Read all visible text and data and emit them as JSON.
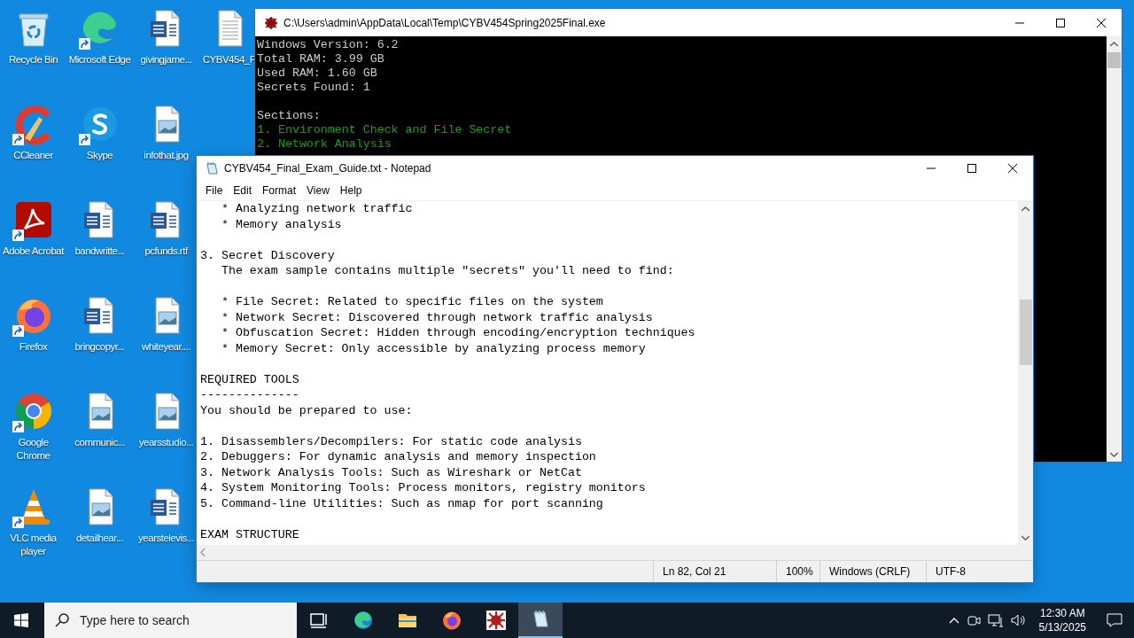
{
  "desktop_icons": [
    {
      "label": "Recycle Bin",
      "kind": "recycle",
      "shortcut": false
    },
    {
      "label": "CCleaner",
      "kind": "ccleaner",
      "shortcut": true
    },
    {
      "label": "Adobe Acrobat",
      "kind": "acrobat",
      "shortcut": true
    },
    {
      "label": "Firefox",
      "kind": "firefox",
      "shortcut": true
    },
    {
      "label": "Google Chrome",
      "kind": "chrome",
      "shortcut": true
    },
    {
      "label": "VLC media player",
      "kind": "vlc",
      "shortcut": true
    },
    {
      "label": "Microsoft Edge",
      "kind": "edge",
      "shortcut": true
    },
    {
      "label": "Skype",
      "kind": "skype",
      "shortcut": true
    },
    {
      "label": "bandwritte...",
      "kind": "word",
      "shortcut": false
    },
    {
      "label": "bringcopyr...",
      "kind": "word",
      "shortcut": false
    },
    {
      "label": "communic...",
      "kind": "image",
      "shortcut": false
    },
    {
      "label": "detailhear...",
      "kind": "image",
      "shortcut": false
    },
    {
      "label": "givingjame...",
      "kind": "word",
      "shortcut": false
    },
    {
      "label": "infothat.jpg",
      "kind": "image",
      "shortcut": false
    },
    {
      "label": "pcfunds.rtf",
      "kind": "word",
      "shortcut": false
    },
    {
      "label": "whiteyear....",
      "kind": "image",
      "shortcut": false
    },
    {
      "label": "yearsstudio...",
      "kind": "image",
      "shortcut": false
    },
    {
      "label": "yearstelevis...",
      "kind": "word",
      "shortcut": false
    },
    {
      "label": "CYBV454_F",
      "kind": "text",
      "shortcut": false
    }
  ],
  "console_window": {
    "title": "C:\\Users\\admin\\AppData\\Local\\Temp\\CYBV454Spring2025Final.exe",
    "blocks": [
      [
        {
          "text": "Windows Version: 6.2",
          "color": "#cccccc"
        },
        {
          "text": "Total RAM: 3.99 GB",
          "color": "#cccccc"
        },
        {
          "text": "Used RAM: 1.60 GB",
          "color": "#cccccc"
        },
        {
          "text": "Secrets Found: 1",
          "color": "#cccccc"
        }
      ],
      [
        {
          "text": "Sections:",
          "color": "#cccccc"
        },
        {
          "text": "1. Environment Check and File Secret",
          "color": "#13a10e"
        },
        {
          "text": "2. Network Analysis",
          "color": "#13a10e"
        }
      ]
    ]
  },
  "notepad_window": {
    "title": "CYBV454_Final_Exam_Guide.txt - Notepad",
    "menu": [
      "File",
      "Edit",
      "Format",
      "View",
      "Help"
    ],
    "blocks": [
      [
        "   * Analyzing network traffic",
        "   * Memory analysis"
      ],
      [
        "3. Secret Discovery",
        "   The exam sample contains multiple \"secrets\" you'll need to find:"
      ],
      [
        "   * File Secret: Related to specific files on the system",
        "   * Network Secret: Discovered through network traffic analysis",
        "   * Obfuscation Secret: Hidden through encoding/encryption techniques",
        "   * Memory Secret: Only accessible by analyzing process memory"
      ],
      [
        "REQUIRED TOOLS",
        "--------------",
        "You should be prepared to use:"
      ],
      [
        "1. Disassemblers/Decompilers: For static code analysis",
        "2. Debuggers: For dynamic analysis and memory inspection",
        "3. Network Analysis Tools: Such as Wireshark or NetCat",
        "4. System Monitoring Tools: Process monitors, registry monitors",
        "5. Command-line Utilities: Such as nmap for port scanning"
      ],
      [
        "EXAM STRUCTURE"
      ]
    ],
    "status_bar": [
      "Ln 82, Col 21",
      "100%",
      "Windows (CRLF)",
      "UTF-8"
    ]
  },
  "taskbar": {
    "search": {
      "placeholder": "Type here to search"
    },
    "apps": [
      {
        "kind": "taskview",
        "active": false
      },
      {
        "kind": "edge",
        "active": false
      },
      {
        "kind": "folder",
        "active": false
      },
      {
        "kind": "firefox",
        "active": false
      },
      {
        "kind": "malware",
        "active": false
      },
      {
        "kind": "notepad",
        "active": true
      }
    ],
    "clock": {
      "time": "12:30 AM",
      "date": "5/13/2025"
    }
  }
}
